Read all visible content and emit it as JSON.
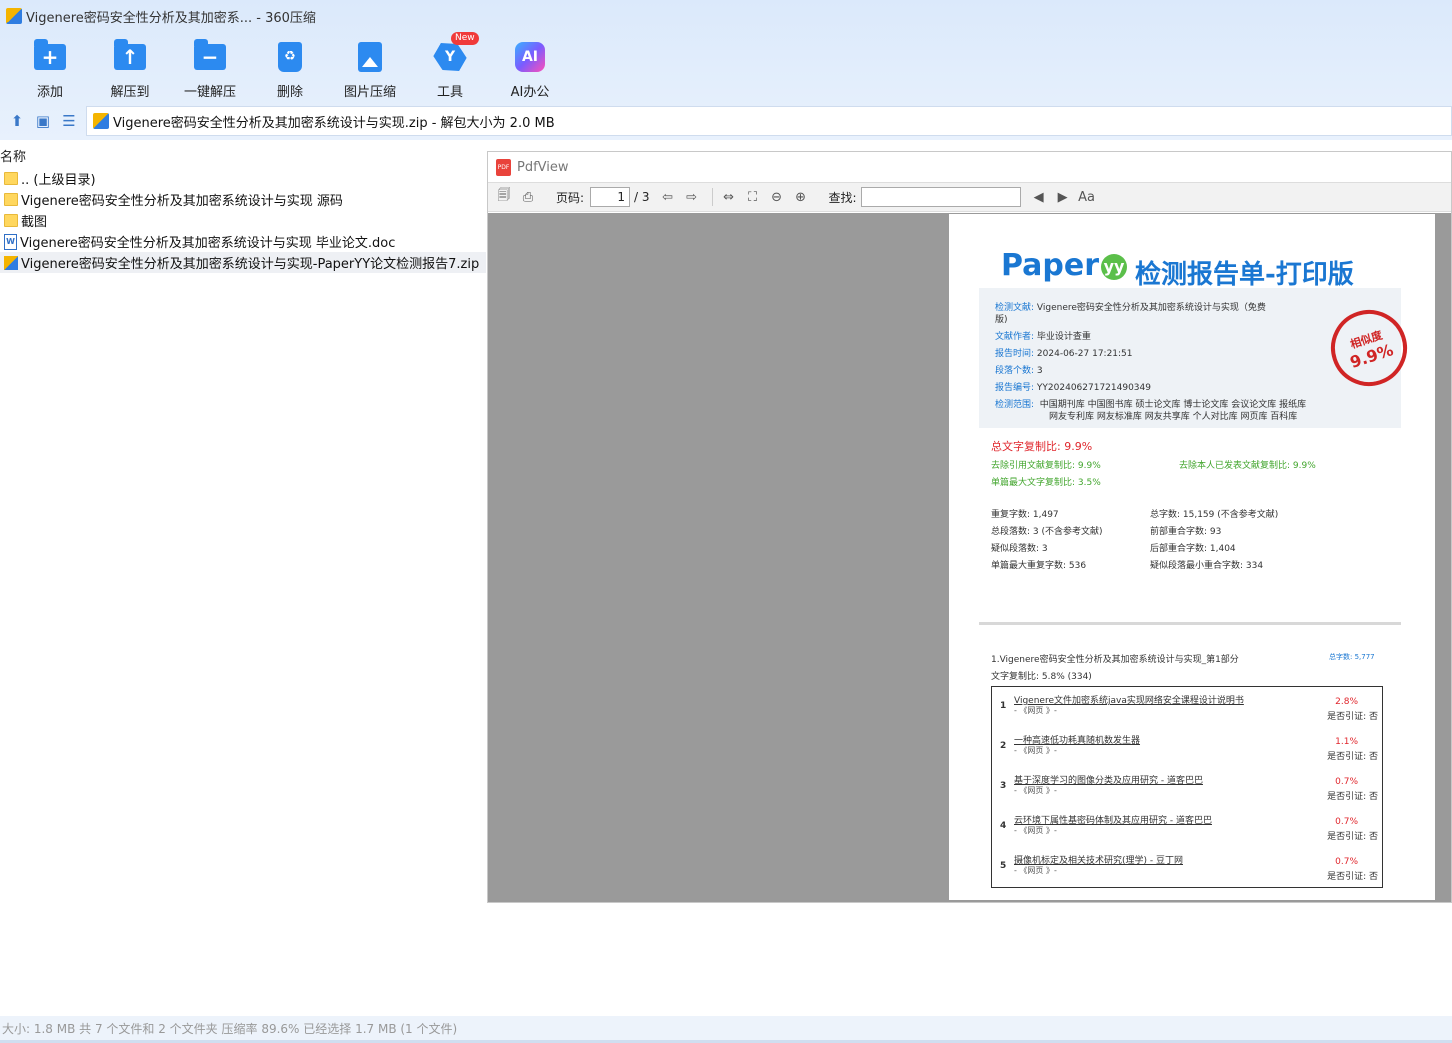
{
  "window": {
    "title": "Vigenere密码安全性分析及其加密系... - 360压缩"
  },
  "toolbar": {
    "add": "添加",
    "extract_to": "解压到",
    "one_click_extract": "一键解压",
    "delete": "删除",
    "image_compress": "图片压缩",
    "tools": "工具",
    "tools_badge": "New",
    "ai_office": "AI办公"
  },
  "path": {
    "text": "Vigenere密码安全性分析及其加密系统设计与实现.zip - 解包大小为 2.0 MB"
  },
  "filelist": {
    "column_name": "名称",
    "items": [
      {
        "name": ".. (上级目录)"
      },
      {
        "name": "Vigenere密码安全性分析及其加密系统设计与实现 源码"
      },
      {
        "name": "截图"
      },
      {
        "name": "Vigenere密码安全性分析及其加密系统设计与实现 毕业论文.doc"
      },
      {
        "name": "Vigenere密码安全性分析及其加密系统设计与实现-PaperYY论文检测报告7.zip"
      }
    ]
  },
  "pdfview": {
    "title": "PdfView",
    "page_label": "页码:",
    "page_value": "1",
    "page_total": "/ 3",
    "search_label": "查找:"
  },
  "report": {
    "brand": "Paper",
    "brand_mark": "yy",
    "title": "检测报告单-打印版",
    "info": {
      "doc_label": "检测文献:",
      "doc_value": "Vigenere密码安全性分析及其加密系统设计与实现（免费",
      "doc_value2": "版)",
      "author_label": "文献作者:",
      "author_value": "毕业设计查重",
      "time_label": "报告时间:",
      "time_value": "2024-06-27 17:21:51",
      "paras_label": "段落个数:",
      "paras_value": "3",
      "id_label": "报告编号:",
      "id_value": "YY202406271721490349",
      "scope_label": "检测范围:",
      "scope_line1": "中国期刊库 中国图书库 硕士论文库 博士论文库 会议论文库 报纸库",
      "scope_line2": "网友专利库 网友标准库 网友共享库 个人对比库 网页库 百科库"
    },
    "stamp_top": "相似度",
    "stamp_value": "9.9%",
    "total_ratio": "总文字复制比: 9.9%",
    "excl_quote": "去除引用文献复制比: 9.9%",
    "excl_self": "去除本人已发表文献复制比: 9.9%",
    "max_single": "单篇最大文字复制比: 3.5%",
    "stats": {
      "dup_chars": "重复字数: 1,497",
      "total_chars": "总字数: 15,159 (不含参考文献)",
      "total_paras": "总段落数: 3 (不含参考文献)",
      "front_overlap": "前部重合字数: 93",
      "suspect_paras": "疑似段落数: 3",
      "back_overlap": "后部重合字数: 1,404",
      "max_dup": "单篇最大重复字数: 536",
      "min_suspect": "疑似段落最小重合字数: 334"
    },
    "part1_title": "1.Vigenere密码安全性分析及其加密系统设计与实现_第1部分",
    "part1_total": "总字数: 5,777",
    "part1_ratio": "文字复制比: 5.8% (334)",
    "sources": [
      {
        "no": "1",
        "title": "Vigenere文件加密系统java实现网络安全课程设计说明书",
        "src": "- 《网页 》-",
        "pct": "2.8%",
        "cite": "是否引证: 否"
      },
      {
        "no": "2",
        "title": "一种高速低功耗真随机数发生器",
        "src": "- 《网页 》-",
        "pct": "1.1%",
        "cite": "是否引证: 否"
      },
      {
        "no": "3",
        "title": "基于深度学习的图像分类及应用研究 - 道客巴巴",
        "src": "- 《网页 》-",
        "pct": "0.7%",
        "cite": "是否引证: 否"
      },
      {
        "no": "4",
        "title": "云环境下属性基密码体制及其应用研究 - 道客巴巴",
        "src": "- 《网页 》-",
        "pct": "0.7%",
        "cite": "是否引证: 否"
      },
      {
        "no": "5",
        "title": "摄像机标定及相关技术研究(理学) - 豆丁网",
        "src": "- 《网页 》-",
        "pct": "0.7%",
        "cite": "是否引证: 否"
      }
    ]
  },
  "status": {
    "text": "大小: 1.8 MB 共 7 个文件和 2 个文件夹 压缩率 89.6% 已经选择 1.7 MB (1 个文件)"
  }
}
